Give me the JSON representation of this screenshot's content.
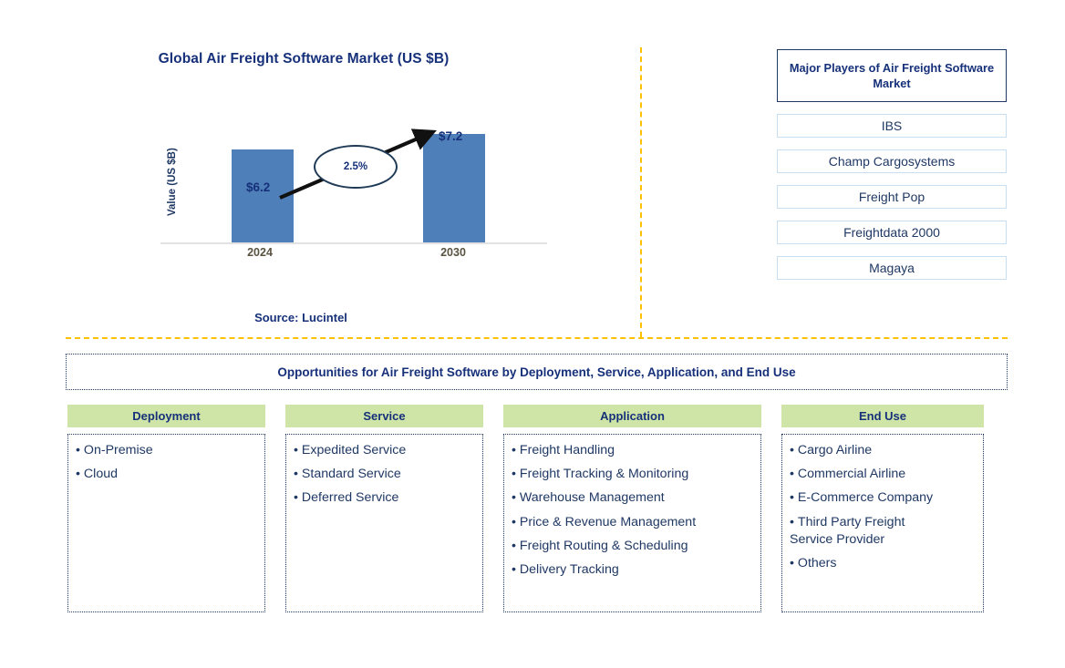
{
  "chart_data": {
    "type": "bar",
    "title": "Global Air Freight Software Market (US $B)",
    "xlabel": "",
    "ylabel": "Value (US $B)",
    "categories": [
      "2024",
      "2030"
    ],
    "values": [
      6.2,
      7.2
    ],
    "value_labels": [
      "$6.2",
      "$7.2"
    ],
    "ylim": [
      0,
      8.8
    ],
    "grid": false,
    "legend": null,
    "bar_color": "#4e7fb9",
    "annotation": {
      "label": "2.5%",
      "kind": "cagr-bubble-arrow",
      "from_category": "2024",
      "to_category": "2030"
    },
    "source": "Source: Lucintel"
  },
  "chart": {
    "title": "Global Air Freight Software Market (US $B)",
    "y_axis_label": "Value (US $B)",
    "tick_labels": [
      "2024",
      "2030"
    ],
    "bar_labels": [
      "$6.2",
      "$7.2"
    ],
    "cagr": "2.5%",
    "source": "Source: Lucintel"
  },
  "players": {
    "header": "Major Players of Air Freight Software Market",
    "items": [
      "IBS",
      "Champ Cargosystems",
      "Freight Pop",
      "Freightdata 2000",
      "Magaya"
    ]
  },
  "opportunities": {
    "banner": "Opportunities for Air Freight Software by Deployment, Service, Application, and End Use",
    "columns": [
      {
        "header": "Deployment",
        "items": [
          "On-Premise",
          "Cloud"
        ]
      },
      {
        "header": "Service",
        "items": [
          "Expedited Service",
          "Standard Service",
          "Deferred Service"
        ]
      },
      {
        "header": "Application",
        "items": [
          "Freight Handling",
          "Freight Tracking & Monitoring",
          "Warehouse Management",
          "Price & Revenue Management",
          "Freight Routing & Scheduling",
          "Delivery Tracking"
        ]
      },
      {
        "header": "End Use",
        "items": [
          "Cargo Airline",
          "Commercial Airline",
          "E-Commerce Company",
          "Third Party Freight\n Service Provider",
          "Others"
        ]
      }
    ]
  },
  "colors": {
    "navy": "#16307a",
    "bar_blue": "#4e7fb9",
    "header_green": "#cfe5a7",
    "divider_orange": "#ffc000",
    "player_border": "#c7ddf0"
  }
}
